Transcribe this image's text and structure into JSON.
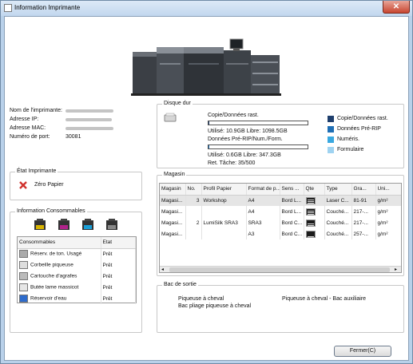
{
  "window": {
    "title": "Information Imprimante",
    "close_glyph": "✕"
  },
  "printer_info": {
    "labels": [
      "Nom de l'imprimante:",
      "Adresse IP:",
      "Adresse MAC:",
      "Numéro de port:"
    ],
    "port_value": "30081"
  },
  "disk": {
    "title": "Disque dur",
    "copy_label": "Copie/Données rast.",
    "copy_usage": "Utilisé: 10.9GB Libre: 1098.5GB",
    "copy_fraction": 0.01,
    "prerip_label": "Données Pré-RIP/Num./Form.",
    "prerip_usage": "Utilisé: 0.6GB Libre: 347.3GB",
    "prerip_fraction": 0.002,
    "retention": "Ret. Tâche: 35/500",
    "legend": [
      {
        "label": "Copie/Données rast.",
        "color": "#1f3f6d"
      },
      {
        "label": "Données Pré-RIP",
        "color": "#1f6fb5"
      },
      {
        "label": "Numéris.",
        "color": "#39a8e0"
      },
      {
        "label": "Formulaire",
        "color": "#9fd3f1"
      }
    ]
  },
  "status": {
    "title": "État Imprimante",
    "text": "Zéro Papier",
    "icon": "error-x-icon"
  },
  "consumables": {
    "title": "Information Consommables",
    "toner_colors": [
      "#d8b400",
      "#b0228a",
      "#1a9fd8",
      "#222222"
    ],
    "headers": [
      "Consommables",
      "Etat"
    ],
    "rows": [
      {
        "name": "Réserv. de ton. Usagé",
        "state": "Prêt",
        "icon": "waste-toner-icon"
      },
      {
        "name": "Corbeille piqueuse",
        "state": "Prêt",
        "icon": "staple-bin-icon"
      },
      {
        "name": "Cartouche d'agrafes",
        "state": "Prêt",
        "icon": "staple-cartridge-icon"
      },
      {
        "name": "Butée lame massicot",
        "state": "Prêt",
        "icon": "trimmer-blade-icon"
      },
      {
        "name": "Réservoir d'eau",
        "state": "Prêt",
        "icon": "water-tank-icon"
      }
    ]
  },
  "tray": {
    "title": "Magasin",
    "headers": [
      "Magasin",
      "No.",
      "Profil Papier",
      "Format de p...",
      "Sens ...",
      "Qte",
      "Type",
      "Gra...",
      "Uni..."
    ],
    "rows": [
      [
        "Magasi...",
        "3",
        "Workshop",
        "A4",
        "Bord L...",
        "",
        "Laser C...",
        "81-91",
        "g/m²"
      ],
      [
        "Magasi...",
        "",
        "",
        "A4",
        "Bord L...",
        "",
        "Couché...",
        "217-...",
        "g/m²"
      ],
      [
        "Magasi...",
        "2",
        "LumiSilk SRA3",
        "SRA3",
        "Bord C...",
        "",
        "Couché...",
        "217-...",
        "g/m²"
      ],
      [
        "Magasi...",
        "",
        "",
        "A3",
        "Bord C...",
        "",
        "Couché...",
        "257-...",
        "g/m²"
      ]
    ]
  },
  "output": {
    "title": "Bac de sortie",
    "items": [
      "Piqueuse à cheval",
      "Piqueuse à cheval - Bac auxiliaire",
      "Bac pliage piqueuse à cheval"
    ]
  },
  "close_button": "Fermer(C)"
}
